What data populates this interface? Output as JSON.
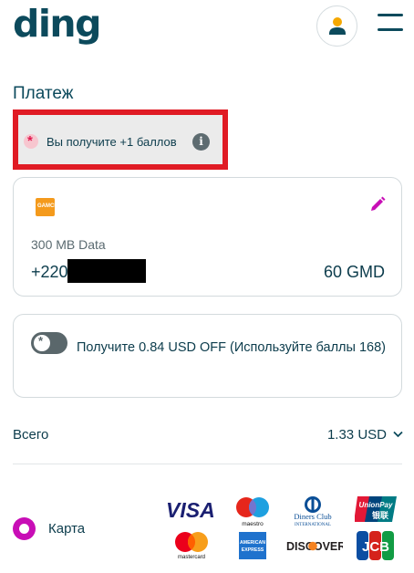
{
  "header": {
    "logo": "ding",
    "account_icon": "user-icon",
    "menu_icon": "hamburger-menu-icon"
  },
  "page": {
    "title": "Платеж"
  },
  "points_banner": {
    "text": "Вы получите +1 баллов",
    "info_icon": "info-icon",
    "highlight_color": "#e01b24"
  },
  "product": {
    "operator_logo_text": "GAMCEL",
    "name": "300 MB Data",
    "phone_visible": "+220",
    "amount": "60 GMD",
    "edit_icon": "pencil-icon"
  },
  "discount": {
    "enabled": false,
    "text": "Получите 0.84 USD OFF (Используйте баллы 168)"
  },
  "total": {
    "label": "Всего",
    "value": "1.33 USD"
  },
  "payment": {
    "label": "Карта",
    "selected": true,
    "brands": {
      "visa": "VISA",
      "maestro": "maestro",
      "diners_line1": "Diners Club",
      "diners_line2": "INTERNATIONAL",
      "unionpay": "UnionPay",
      "unionpay_cn": "银联",
      "mastercard": "mastercard",
      "amex_line1": "AMERICAN",
      "amex_line2": "EXPRESS",
      "discover": "DISCOVER",
      "jcb": "JCB"
    }
  },
  "colors": {
    "brand_dark": "#0c4a5c",
    "accent_magenta": "#c80eb6",
    "highlight_red": "#e01b24"
  }
}
